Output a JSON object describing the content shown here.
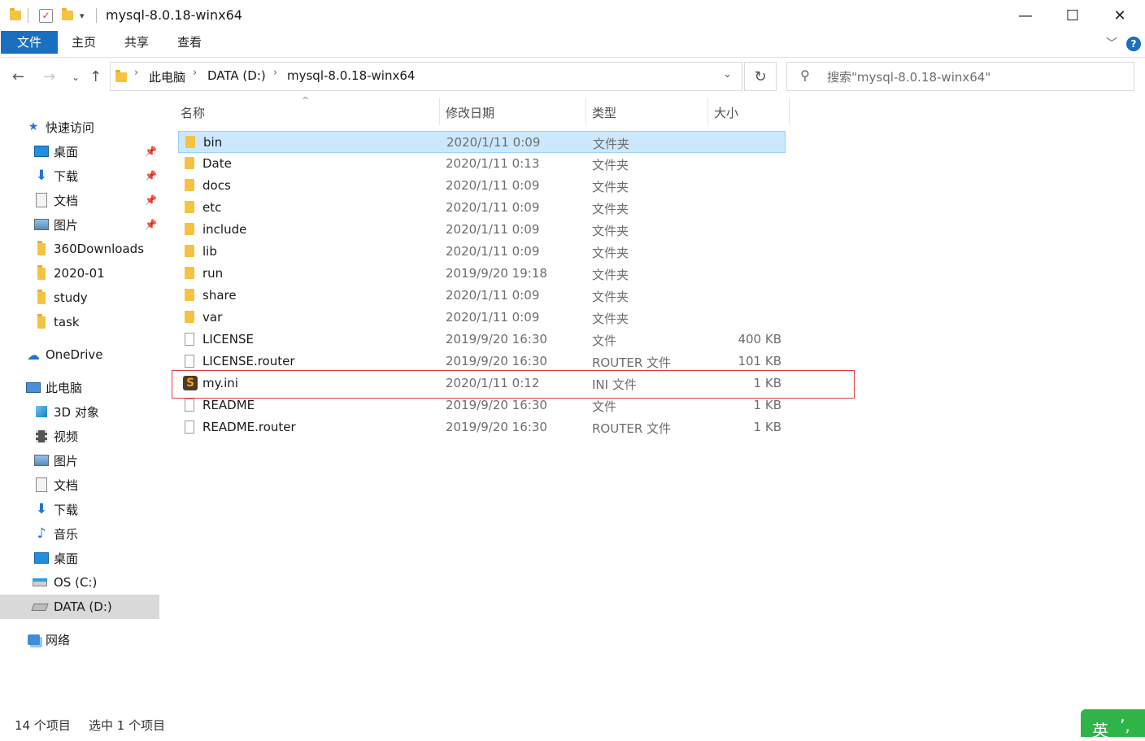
{
  "window": {
    "title": "mysql-8.0.18-winx64",
    "controls": {
      "minimize": "—",
      "maximize": "☐",
      "close": "✕"
    }
  },
  "ribbon": {
    "tabs": [
      "文件",
      "主页",
      "共享",
      "查看"
    ],
    "help_glyph": "?"
  },
  "address": {
    "crumbs": [
      "此电脑",
      "DATA (D:)",
      "mysql-8.0.18-winx64"
    ],
    "search_placeholder": "搜索\"mysql-8.0.18-winx64\""
  },
  "sidebar": {
    "quick_access": {
      "label": "快速访问",
      "items": [
        {
          "label": "桌面",
          "icon": "desktop-icon",
          "pinned": true
        },
        {
          "label": "下载",
          "icon": "download-icon",
          "pinned": true
        },
        {
          "label": "文档",
          "icon": "document-icon",
          "pinned": true
        },
        {
          "label": "图片",
          "icon": "picture-icon",
          "pinned": true
        },
        {
          "label": "360Downloads",
          "icon": "folder-icon",
          "pinned": false
        },
        {
          "label": "2020-01",
          "icon": "folder-icon",
          "pinned": false
        },
        {
          "label": "study",
          "icon": "folder-icon",
          "pinned": false
        },
        {
          "label": "task",
          "icon": "folder-icon",
          "pinned": false
        }
      ]
    },
    "onedrive": {
      "label": "OneDrive"
    },
    "this_pc": {
      "label": "此电脑",
      "items": [
        {
          "label": "3D 对象",
          "icon": "3d-objects-icon"
        },
        {
          "label": "视频",
          "icon": "video-icon"
        },
        {
          "label": "图片",
          "icon": "picture-icon"
        },
        {
          "label": "文档",
          "icon": "document-icon"
        },
        {
          "label": "下载",
          "icon": "download-icon"
        },
        {
          "label": "音乐",
          "icon": "music-icon"
        },
        {
          "label": "桌面",
          "icon": "desktop-icon"
        },
        {
          "label": "OS (C:)",
          "icon": "os-drive-icon"
        },
        {
          "label": "DATA (D:)",
          "icon": "drive-icon",
          "selected": true
        }
      ]
    },
    "network": {
      "label": "网络"
    }
  },
  "columns": {
    "name": "名称",
    "date": "修改日期",
    "type": "类型",
    "size": "大小"
  },
  "files": [
    {
      "name": "bin",
      "date": "2020/1/11 0:09",
      "type": "文件夹",
      "size": "",
      "kind": "folder",
      "selected": true
    },
    {
      "name": "Date",
      "date": "2020/1/11 0:13",
      "type": "文件夹",
      "size": "",
      "kind": "folder"
    },
    {
      "name": "docs",
      "date": "2020/1/11 0:09",
      "type": "文件夹",
      "size": "",
      "kind": "folder"
    },
    {
      "name": "etc",
      "date": "2020/1/11 0:09",
      "type": "文件夹",
      "size": "",
      "kind": "folder"
    },
    {
      "name": "include",
      "date": "2020/1/11 0:09",
      "type": "文件夹",
      "size": "",
      "kind": "folder"
    },
    {
      "name": "lib",
      "date": "2020/1/11 0:09",
      "type": "文件夹",
      "size": "",
      "kind": "folder"
    },
    {
      "name": "run",
      "date": "2019/9/20 19:18",
      "type": "文件夹",
      "size": "",
      "kind": "folder"
    },
    {
      "name": "share",
      "date": "2020/1/11 0:09",
      "type": "文件夹",
      "size": "",
      "kind": "folder"
    },
    {
      "name": "var",
      "date": "2020/1/11 0:09",
      "type": "文件夹",
      "size": "",
      "kind": "folder"
    },
    {
      "name": "LICENSE",
      "date": "2019/9/20 16:30",
      "type": "文件",
      "size": "400 KB",
      "kind": "doc"
    },
    {
      "name": "LICENSE.router",
      "date": "2019/9/20 16:30",
      "type": "ROUTER 文件",
      "size": "101 KB",
      "kind": "doc"
    },
    {
      "name": "my.ini",
      "date": "2020/1/11 0:12",
      "type": "INI 文件",
      "size": "1 KB",
      "kind": "ini",
      "highlighted": true
    },
    {
      "name": "README",
      "date": "2019/9/20 16:30",
      "type": "文件",
      "size": "1 KB",
      "kind": "doc"
    },
    {
      "name": "README.router",
      "date": "2019/9/20 16:30",
      "type": "ROUTER 文件",
      "size": "1 KB",
      "kind": "doc"
    }
  ],
  "status": {
    "count": "14 个项目",
    "selected": "选中 1 个项目"
  },
  "ime": {
    "lang": "英",
    "punct": "ʼ,"
  },
  "colors": {
    "accent": "#1a6fc1",
    "selection": "#cce8ff",
    "highlight_border": "#e23b3b",
    "ime": "#2fb44a"
  }
}
